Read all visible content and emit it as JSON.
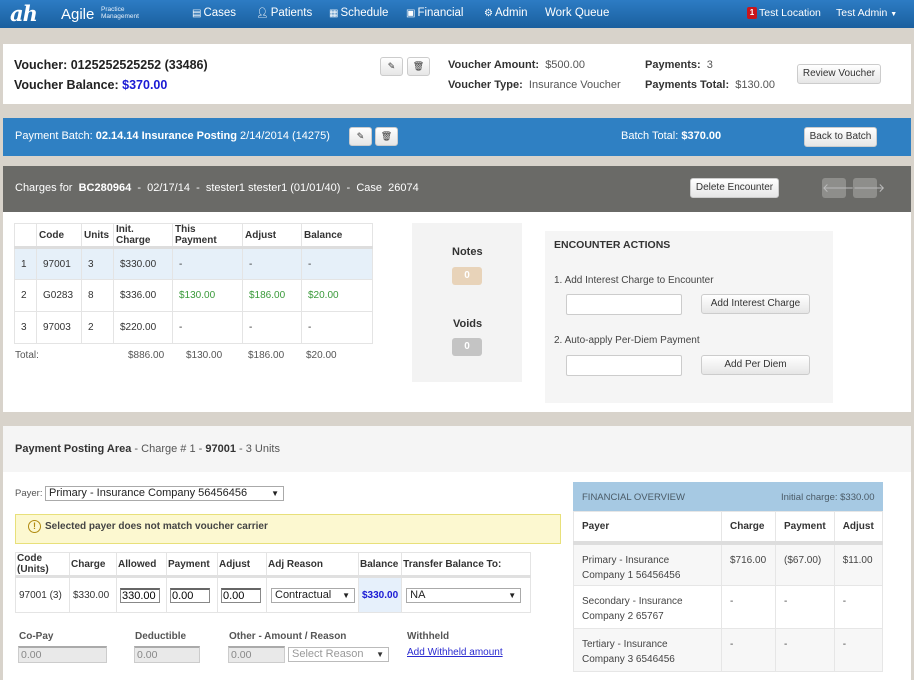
{
  "navbar": {
    "logo": "ah",
    "brand": "Agile",
    "brand_sub_1": "Practice",
    "brand_sub_2": "Management",
    "items": [
      {
        "label": "Cases",
        "icon": "list-icon"
      },
      {
        "label": "Patients",
        "icon": "user-icon"
      },
      {
        "label": "Schedule",
        "icon": "calendar-icon"
      },
      {
        "label": "Financial",
        "icon": "chart-icon"
      },
      {
        "label": "Admin",
        "icon": "gears-icon"
      },
      {
        "label": "Work Queue",
        "icon": ""
      }
    ],
    "location_badge": "1",
    "location": "Test Location",
    "user": "Test Admin"
  },
  "voucher": {
    "voucher_label": "Voucher:",
    "voucher_value": "0125252525252 (33486)",
    "balance_label": "Voucher Balance:",
    "balance_value": "$370.00",
    "amount_label": "Voucher Amount:",
    "amount_value": "$500.00",
    "type_label": "Voucher Type:",
    "type_value": "Insurance Voucher",
    "payments_label": "Payments:",
    "payments_value": "3",
    "payments_total_label": "Payments Total:",
    "payments_total_value": "$130.00",
    "review_button": "Review Voucher"
  },
  "batch": {
    "label": "Payment Batch:",
    "name": "02.14.14 Insurance Posting",
    "date_id": "2/14/2014 (14275)",
    "total_label": "Batch Total:",
    "total_value": "$370.00",
    "back_button": "Back to Batch"
  },
  "charges_header": {
    "prefix": "Charges for",
    "encounter": "BC280964",
    "date": "02/17/14",
    "patient": "stester1 stester1 (01/01/40)",
    "case_label": "Case",
    "case_value": "26074",
    "separator": "-",
    "delete_button": "Delete Encounter"
  },
  "charges_table": {
    "headers": [
      "",
      "Code",
      "Units",
      "Init. Charge",
      "This Payment",
      "Adjust",
      "Balance"
    ],
    "rows": [
      {
        "n": "1",
        "code": "97001",
        "units": "3",
        "init": "$330.00",
        "payment": "-",
        "adjust": "-",
        "balance": "-"
      },
      {
        "n": "2",
        "code": "G0283",
        "units": "8",
        "init": "$336.00",
        "payment": "$130.00",
        "adjust": "$186.00",
        "balance": "$20.00"
      },
      {
        "n": "3",
        "code": "97003",
        "units": "2",
        "init": "$220.00",
        "payment": "-",
        "adjust": "-",
        "balance": "-"
      }
    ],
    "total_label": "Total:",
    "totals": {
      "init": "$886.00",
      "payment": "$130.00",
      "adjust": "$186.00",
      "balance": "$20.00"
    }
  },
  "notes": {
    "label": "Notes",
    "count": "0",
    "color": "#e8d3b9"
  },
  "voids": {
    "label": "Voids",
    "count": "0",
    "color": "#c4c4c4"
  },
  "encounter_actions": {
    "title": "ENCOUNTER ACTIONS",
    "step1": "1. Add Interest Charge to Encounter",
    "step1_value": "",
    "step1_button": "Add Interest Charge",
    "step2": "2. Auto-apply Per-Diem Payment",
    "step2_value": "",
    "step2_button": "Add Per Diem"
  },
  "posting": {
    "title": "Payment Posting Area",
    "charge_label": "- Charge # 1 -",
    "charge_code": "97001",
    "units": "- 3 Units",
    "payer_label": "Payer:",
    "payer_value": "Primary - Insurance Company 56456456",
    "warning": "Selected payer does not match voucher carrier",
    "table_headers": [
      "Code (Units)",
      "Charge",
      "Allowed",
      "Payment",
      "Adjust",
      "Adj Reason",
      "Balance",
      "Transfer Balance To:"
    ],
    "row": {
      "code": "97001 (3)",
      "charge": "$330.00",
      "allowed": "330.00",
      "payment": "0.00",
      "adjust": "0.00",
      "adj_reason": "Contractual",
      "balance": "$330.00",
      "transfer": "NA"
    },
    "copay_label": "Co-Pay",
    "copay_value": "0.00",
    "deductible_label": "Deductible",
    "deductible_value": "0.00",
    "other_label": "Other - Amount / Reason",
    "other_value": "0.00",
    "other_reason_placeholder": "Select Reason",
    "withheld_label": "Withheld",
    "withheld_link": "Add Withheld amount"
  },
  "financial_overview": {
    "title": "FINANCIAL OVERVIEW",
    "initial_charge": "Initial charge: $330.00",
    "headers": [
      "Payer",
      "Charge",
      "Payment",
      "Adjust"
    ],
    "rows": [
      {
        "payer": "Primary - Insurance Company 1 56456456",
        "charge": "$716.00",
        "payment": "($67.00)",
        "adjust": "$11.00"
      },
      {
        "payer": "Secondary - Insurance Company 2 65767",
        "charge": "-",
        "payment": "-",
        "adjust": "-"
      },
      {
        "payer": "Tertiary - Insurance Company 3 6546456",
        "charge": "-",
        "payment": "-",
        "adjust": "-"
      }
    ]
  }
}
